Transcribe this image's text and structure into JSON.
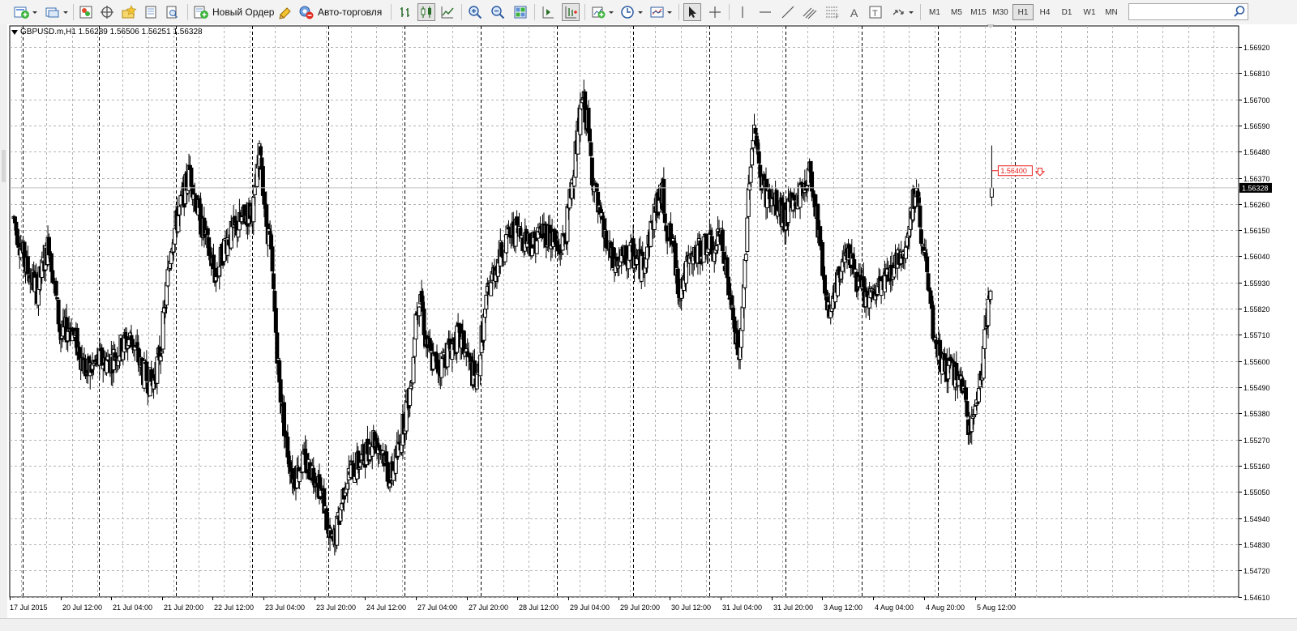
{
  "toolbar": {
    "new_order_label": "Новый Ордер",
    "auto_trading_label": "Авто-торговля",
    "timeframes": [
      "M1",
      "M5",
      "M15",
      "M30",
      "H1",
      "H4",
      "D1",
      "W1",
      "MN"
    ],
    "active_timeframe": "H1",
    "search": {
      "value": "",
      "placeholder": ""
    }
  },
  "chart": {
    "symbol_info": "GBPUSD.m,H1  1.56289 1.56506 1.56251 1.56328",
    "current_price": "1.56328",
    "alert_price": "1.56400",
    "colors": {
      "background": "#ffffff",
      "grid": "#b4b4b4",
      "candle": "#000000",
      "alert": "#e8201c",
      "bid_line": "#c0c0c0",
      "price_tag_bg": "#000000",
      "price_tag_text": "#ffffff"
    },
    "price_axis_labels": [
      "1.56920",
      "1.56810",
      "1.56700",
      "1.56590",
      "1.56480",
      "1.56370",
      "1.56260",
      "1.56150",
      "1.56040",
      "1.55930",
      "1.55820",
      "1.55710",
      "1.55600",
      "1.55490",
      "1.55380",
      "1.55270",
      "1.55160",
      "1.55050",
      "1.54940",
      "1.54830",
      "1.54720",
      "1.54610"
    ],
    "time_axis_labels": [
      "17 Jul 2015",
      "20 Jul 12:00",
      "21 Jul 04:00",
      "21 Jul 20:00",
      "22 Jul 12:00",
      "23 Jul 04:00",
      "23 Jul 20:00",
      "24 Jul 12:00",
      "27 Jul 04:00",
      "27 Jul 20:00",
      "28 Jul 12:00",
      "29 Jul 04:00",
      "29 Jul 20:00",
      "30 Jul 12:00",
      "31 Jul 04:00",
      "31 Jul 20:00",
      "3 Aug 12:00",
      "4 Aug 04:00",
      "4 Aug 20:00",
      "5 Aug 12:00"
    ]
  },
  "chart_data": {
    "type": "candlestick",
    "symbol": "GBPUSD.m",
    "timeframe": "H1",
    "ylim": [
      1.5461,
      1.5697
    ],
    "y_ticks": [
      1.5692,
      1.5681,
      1.567,
      1.5659,
      1.5648,
      1.5637,
      1.5626,
      1.5615,
      1.5604,
      1.5593,
      1.5582,
      1.5571,
      1.556,
      1.5549,
      1.5538,
      1.5527,
      1.5516,
      1.5505,
      1.5494,
      1.5483,
      1.5472,
      1.5461
    ],
    "x_ticks": [
      "17 Jul 2015",
      "20 Jul 12:00",
      "21 Jul 04:00",
      "21 Jul 20:00",
      "22 Jul 12:00",
      "23 Jul 04:00",
      "23 Jul 20:00",
      "24 Jul 12:00",
      "27 Jul 04:00",
      "27 Jul 20:00",
      "28 Jul 12:00",
      "29 Jul 04:00",
      "29 Jul 20:00",
      "30 Jul 12:00",
      "31 Jul 04:00",
      "31 Jul 20:00",
      "3 Aug 12:00",
      "4 Aug 04:00",
      "4 Aug 20:00",
      "5 Aug 12:00"
    ],
    "last_bar": {
      "open": 1.56289,
      "high": 1.56506,
      "low": 1.56251,
      "close": 1.56328
    },
    "alert_level": 1.564,
    "close_path": [
      [
        0,
        1.562
      ],
      [
        10,
        1.56
      ],
      [
        20,
        1.559
      ],
      [
        30,
        1.561
      ],
      [
        40,
        1.557
      ],
      [
        48,
        1.5575
      ],
      [
        55,
        1.5565
      ],
      [
        62,
        1.5555
      ],
      [
        72,
        1.556
      ],
      [
        82,
        1.556
      ],
      [
        90,
        1.5565
      ],
      [
        100,
        1.557
      ],
      [
        110,
        1.5555
      ],
      [
        118,
        1.555
      ],
      [
        125,
        1.5565
      ],
      [
        130,
        1.559
      ],
      [
        134,
        1.561
      ],
      [
        142,
        1.5625
      ],
      [
        150,
        1.564
      ],
      [
        158,
        1.562
      ],
      [
        164,
        1.561
      ],
      [
        172,
        1.5595
      ],
      [
        180,
        1.561
      ],
      [
        188,
        1.5615
      ],
      [
        196,
        1.562
      ],
      [
        204,
        1.5625
      ],
      [
        210,
        1.565
      ],
      [
        214,
        1.562
      ],
      [
        218,
        1.561
      ],
      [
        222,
        1.558
      ],
      [
        226,
        1.555
      ],
      [
        232,
        1.5525
      ],
      [
        238,
        1.551
      ],
      [
        245,
        1.5518
      ],
      [
        252,
        1.5515
      ],
      [
        258,
        1.5512
      ],
      [
        264,
        1.55
      ],
      [
        268,
        1.5485
      ],
      [
        272,
        1.5483
      ],
      [
        276,
        1.5492
      ],
      [
        282,
        1.551
      ],
      [
        290,
        1.5515
      ],
      [
        298,
        1.552
      ],
      [
        306,
        1.5528
      ],
      [
        314,
        1.5522
      ],
      [
        320,
        1.551
      ],
      [
        326,
        1.552
      ],
      [
        332,
        1.5535
      ],
      [
        338,
        1.555
      ],
      [
        342,
        1.558
      ],
      [
        346,
        1.559
      ],
      [
        350,
        1.557
      ],
      [
        356,
        1.556
      ],
      [
        362,
        1.5558
      ],
      [
        370,
        1.5565
      ],
      [
        378,
        1.557
      ],
      [
        384,
        1.5565
      ],
      [
        390,
        1.5555
      ],
      [
        394,
        1.555
      ],
      [
        398,
        1.557
      ],
      [
        404,
        1.559
      ],
      [
        410,
        1.56
      ],
      [
        418,
        1.561
      ],
      [
        426,
        1.5615
      ],
      [
        434,
        1.5612
      ],
      [
        442,
        1.561
      ],
      [
        450,
        1.5615
      ],
      [
        458,
        1.5612
      ],
      [
        464,
        1.5605
      ],
      [
        470,
        1.5615
      ],
      [
        476,
        1.564
      ],
      [
        480,
        1.5655
      ],
      [
        484,
        1.567
      ],
      [
        488,
        1.566
      ],
      [
        492,
        1.564
      ],
      [
        498,
        1.562
      ],
      [
        504,
        1.561
      ],
      [
        510,
        1.56
      ],
      [
        518,
        1.5602
      ],
      [
        526,
        1.5605
      ],
      [
        534,
        1.56
      ],
      [
        540,
        1.561
      ],
      [
        546,
        1.5625
      ],
      [
        552,
        1.563
      ],
      [
        556,
        1.5615
      ],
      [
        560,
        1.561
      ],
      [
        566,
        1.559
      ],
      [
        574,
        1.56
      ],
      [
        582,
        1.5605
      ],
      [
        590,
        1.561
      ],
      [
        596,
        1.5605
      ],
      [
        602,
        1.5615
      ],
      [
        608,
        1.559
      ],
      [
        614,
        1.557
      ],
      [
        618,
        1.556
      ],
      [
        622,
        1.56
      ],
      [
        626,
        1.564
      ],
      [
        630,
        1.566
      ],
      [
        634,
        1.564
      ],
      [
        640,
        1.563
      ],
      [
        648,
        1.5625
      ],
      [
        656,
        1.562
      ],
      [
        662,
        1.5625
      ],
      [
        668,
        1.563
      ],
      [
        674,
        1.5635
      ],
      [
        678,
        1.564
      ],
      [
        682,
        1.5625
      ],
      [
        686,
        1.561
      ],
      [
        690,
        1.559
      ],
      [
        696,
        1.558
      ],
      [
        702,
        1.5595
      ],
      [
        708,
        1.561
      ],
      [
        714,
        1.56
      ],
      [
        720,
        1.559
      ],
      [
        728,
        1.5585
      ],
      [
        736,
        1.559
      ],
      [
        742,
        1.5595
      ],
      [
        748,
        1.56
      ],
      [
        754,
        1.5605
      ],
      [
        760,
        1.561
      ],
      [
        764,
        1.5625
      ],
      [
        768,
        1.563
      ],
      [
        772,
        1.5615
      ],
      [
        776,
        1.56
      ],
      [
        780,
        1.558
      ],
      [
        784,
        1.5565
      ],
      [
        790,
        1.556
      ],
      [
        796,
        1.5555
      ],
      [
        802,
        1.5555
      ],
      [
        808,
        1.5545
      ],
      [
        812,
        1.5535
      ],
      [
        816,
        1.5535
      ],
      [
        820,
        1.5545
      ],
      [
        824,
        1.556
      ],
      [
        828,
        1.558
      ],
      [
        832,
        1.559
      ]
    ]
  }
}
